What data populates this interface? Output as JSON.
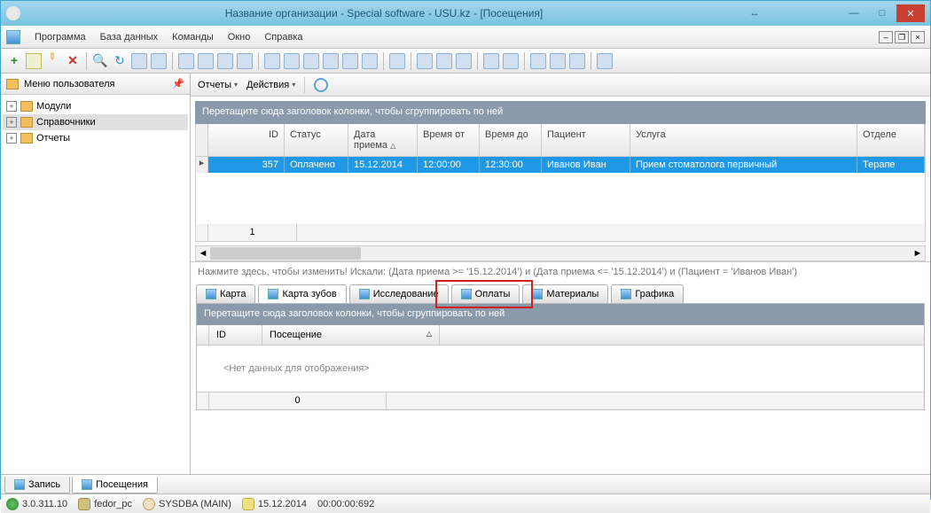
{
  "window": {
    "title": "Название организации - Special software - USU.kz - [Посещения]"
  },
  "menubar": {
    "items": [
      "Программа",
      "База данных",
      "Команды",
      "Окно",
      "Справка"
    ]
  },
  "sidebar": {
    "title": "Меню пользователя",
    "items": [
      "Модули",
      "Справочники",
      "Отчеты"
    ]
  },
  "actions": {
    "reports": "Отчеты",
    "ops": "Действия"
  },
  "grid": {
    "group_hint": "Перетащите сюда заголовок колонки, чтобы сгруппировать по ней",
    "cols": {
      "id": "ID",
      "status": "Статус",
      "date": "Дата приема",
      "tfrom": "Время от",
      "tto": "Время до",
      "patient": "Пациент",
      "service": "Услуга",
      "dept": "Отделе"
    },
    "row": {
      "id": "357",
      "status": "Оплачено",
      "date": "15.12.2014",
      "tfrom": "12:00:00",
      "tto": "12:30:00",
      "patient": "Иванов Иван",
      "service": "Прием стоматолога первичный",
      "dept": "Терапе"
    },
    "count": "1"
  },
  "filter": {
    "text": "Нажмите здесь, чтобы изменить! Искали: (Дата приема  >= '15.12.2014') и (Дата приема  <= '15.12.2014') и (Пациент = 'Иванов Иван')"
  },
  "tabs": {
    "items": [
      "Карта",
      "Карта зубов",
      "Исследование",
      "Оплаты",
      "Материалы",
      "Графика"
    ]
  },
  "subgrid": {
    "group_hint": "Перетащите сюда заголовок колонки, чтобы сгруппировать по ней",
    "cols": {
      "id": "ID",
      "visit": "Посещение"
    },
    "nodata": "<Нет данных для отображения>",
    "count": "0"
  },
  "bottom_tabs": {
    "items": [
      "Запись",
      "Посещения"
    ]
  },
  "status": {
    "version": "3.0.311.10",
    "host": "fedor_pc",
    "user": "SYSDBA (MAIN)",
    "date": "15.12.2014",
    "time": "00:00:00:692"
  }
}
